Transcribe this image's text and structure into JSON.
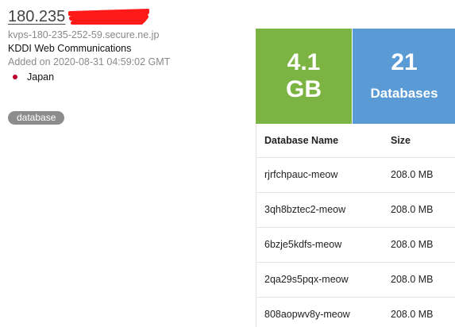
{
  "host": {
    "ip": "180.235",
    "hostname": "kvps-180-235-252-59.secure.ne.jp",
    "organization": "KDDI Web Communications",
    "added": "Added on 2020-08-31 04:59:02 GMT",
    "country": "Japan",
    "flag_icon": "japan-flag-icon",
    "tag": "database"
  },
  "stats": {
    "size_value": "4.1",
    "size_unit": "GB",
    "db_count": "21",
    "db_label": "Databases",
    "size_color": "#7cb443",
    "count_color": "#5a9bd5"
  },
  "table": {
    "headers": {
      "name": "Database Name",
      "size": "Size"
    },
    "rows": [
      {
        "name": "rjrfchpauc-meow",
        "size": "208.0 MB"
      },
      {
        "name": "3qh8bztec2-meow",
        "size": "208.0 MB"
      },
      {
        "name": "6bzje5kdfs-meow",
        "size": "208.0 MB"
      },
      {
        "name": "2qa29s5pqx-meow",
        "size": "208.0 MB"
      },
      {
        "name": "808aopwv8y-meow",
        "size": "208.0 MB"
      }
    ]
  }
}
